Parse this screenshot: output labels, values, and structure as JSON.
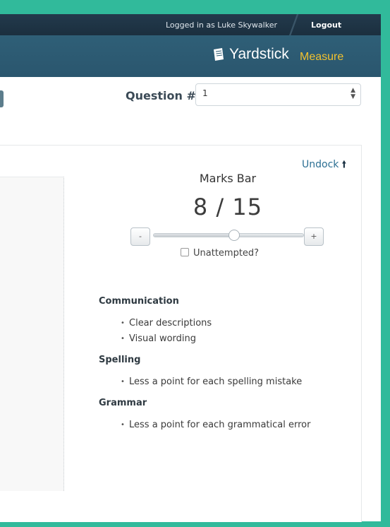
{
  "header": {
    "logged_in_text": "Logged in as Luke Skywalker",
    "logout_label": "Logout",
    "brand_name": "Yardstick",
    "brand_sub": "Measure"
  },
  "question": {
    "label": "Question #",
    "selected": "1"
  },
  "marks": {
    "undock_label": "Undock",
    "title": "Marks Bar",
    "score_text": "8 / 15",
    "score": 8,
    "max": 15,
    "minus_label": "-",
    "plus_label": "+",
    "unattempted_label": "Unattempted?"
  },
  "criteria": [
    {
      "title": "Communication",
      "items": [
        "Clear descriptions",
        "Visual wording"
      ]
    },
    {
      "title": "Spelling",
      "items": [
        "Less a point for each spelling mistake"
      ]
    },
    {
      "title": "Grammar",
      "items": [
        "Less a point for each grammatical error"
      ]
    }
  ],
  "colors": {
    "frame": "#31ba9b",
    "topbar": "#1f3445",
    "brandbar": "#2c5a72",
    "accent": "#f2c12e",
    "link": "#2c6f93"
  }
}
